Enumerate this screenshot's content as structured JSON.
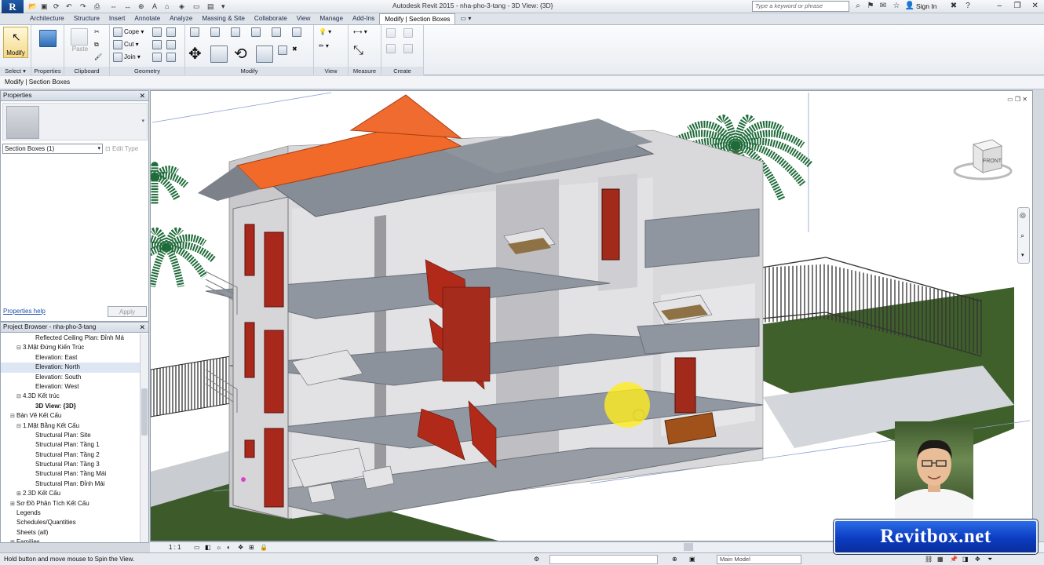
{
  "titlebar": {
    "app_letter": "R",
    "title": "Autodesk Revit 2015 -   nha-pho-3-tang - 3D View: {3D}",
    "search_placeholder": "Type a keyword or phrase",
    "sign_in": "Sign In"
  },
  "tabs": [
    "Architecture",
    "Structure",
    "Insert",
    "Annotate",
    "Analyze",
    "Massing & Site",
    "Collaborate",
    "View",
    "Manage",
    "Add-Ins",
    "Modify | Section Boxes"
  ],
  "ribbon": {
    "modify_label": "Modify",
    "select_label": "Select",
    "properties_label": "Properties",
    "clipboard_label": "Clipboard",
    "paste_label": "Paste",
    "geometry_label": "Geometry",
    "cope_label": "Cope",
    "cut_label": "Cut",
    "join_label": "Join",
    "modify_panel_label": "Modify",
    "view_label": "View",
    "measure_label": "Measure",
    "create_label": "Create"
  },
  "context_bar": "Modify | Section Boxes",
  "properties": {
    "title": "Properties",
    "type_selector": "Section Boxes (1)",
    "edit_type": "Edit Type",
    "help_link": "Properties help",
    "apply": "Apply"
  },
  "browser": {
    "title": "Project Browser - nha-pho-3-tang",
    "items": [
      {
        "label": "Reflected Ceiling Plan: Đỉnh Má",
        "indent": 4,
        "toggle": ""
      },
      {
        "label": "3.Mặt Đứng Kiến Trúc",
        "indent": 2,
        "toggle": "⊟"
      },
      {
        "label": "Elevation: East",
        "indent": 4,
        "toggle": ""
      },
      {
        "label": "Elevation: North",
        "indent": 4,
        "toggle": "",
        "selected": true
      },
      {
        "label": "Elevation: South",
        "indent": 4,
        "toggle": ""
      },
      {
        "label": "Elevation: West",
        "indent": 4,
        "toggle": ""
      },
      {
        "label": "4.3D Kết trúc",
        "indent": 2,
        "toggle": "⊟"
      },
      {
        "label": "3D View: {3D}",
        "indent": 4,
        "toggle": "",
        "bold": true
      },
      {
        "label": "Bản Vẽ Kết Cấu",
        "indent": 1,
        "toggle": "⊟"
      },
      {
        "label": "1.Mặt Bằng Kết Cấu",
        "indent": 2,
        "toggle": "⊟"
      },
      {
        "label": "Structural Plan: Site",
        "indent": 4,
        "toggle": ""
      },
      {
        "label": "Structural Plan: Tầng 1",
        "indent": 4,
        "toggle": ""
      },
      {
        "label": "Structural Plan: Tầng 2",
        "indent": 4,
        "toggle": ""
      },
      {
        "label": "Structural Plan: Tầng 3",
        "indent": 4,
        "toggle": ""
      },
      {
        "label": "Structural Plan: Tầng Mái",
        "indent": 4,
        "toggle": ""
      },
      {
        "label": "Structural Plan: Đỉnh Mái",
        "indent": 4,
        "toggle": ""
      },
      {
        "label": "2.3D Kết Cấu",
        "indent": 2,
        "toggle": "⊞"
      },
      {
        "label": "Sơ Đồ Phân Tích Kết Cấu",
        "indent": 1,
        "toggle": "⊞"
      },
      {
        "label": "Legends",
        "indent": 1,
        "toggle": ""
      },
      {
        "label": "Schedules/Quantities",
        "indent": 1,
        "toggle": ""
      },
      {
        "label": "Sheets (all)",
        "indent": 1,
        "toggle": ""
      },
      {
        "label": "Families",
        "indent": 1,
        "toggle": "⊞"
      }
    ]
  },
  "viewcube_label": "FRONT",
  "view_bar": {
    "scale": "1 : 1"
  },
  "status": {
    "hint": "Hold button and move mouse to Spin the View.",
    "model": "Main Model"
  },
  "brand": "Revitbox.net",
  "colors": {
    "accent": "#0b3cc2",
    "roof": "#f26a2a",
    "door": "#a8281c",
    "context_tab": "#ffffff"
  }
}
